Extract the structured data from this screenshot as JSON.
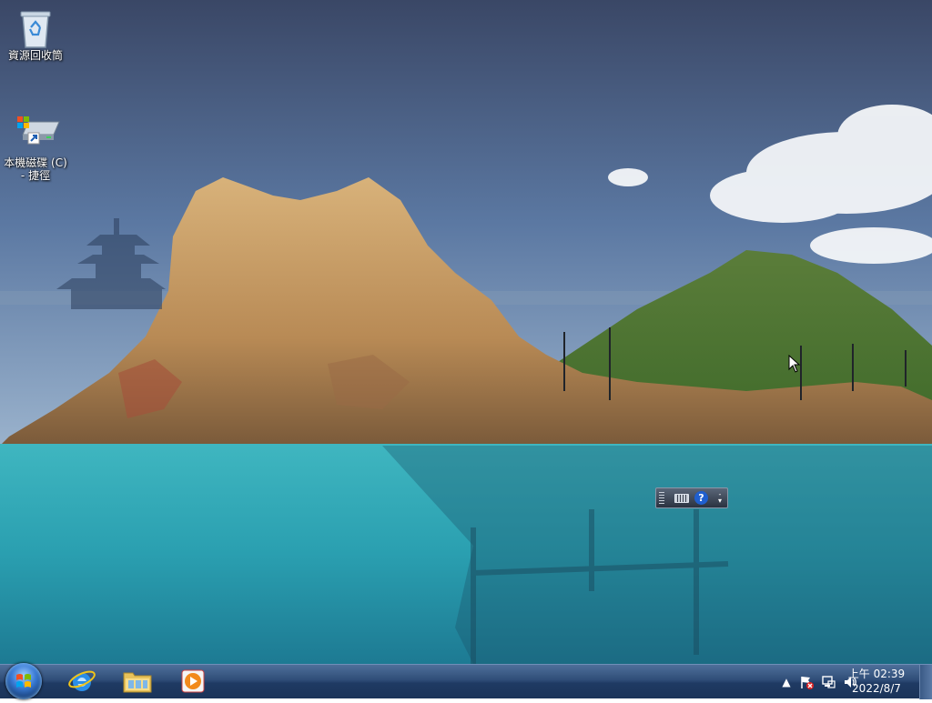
{
  "desktop": {
    "icons": [
      {
        "label": "資源回收筒",
        "icon": "recycle-bin-icon"
      },
      {
        "label": "本機磁碟 (C)\n- 捷徑",
        "icon": "drive-shortcut-icon"
      }
    ]
  },
  "taskbar": {
    "pinned": [
      {
        "name": "internet-explorer",
        "icon": "ie-icon"
      },
      {
        "name": "file-explorer",
        "icon": "folder-icon"
      },
      {
        "name": "media-player",
        "icon": "media-player-icon"
      }
    ],
    "clock": {
      "time": "上午 02:39",
      "date": "2022/8/7"
    },
    "tray_icons": [
      "show-hidden-icons",
      "action-center-flag-icon",
      "network-icon",
      "volume-icon"
    ]
  },
  "language_bar": {
    "help_symbol": "?"
  },
  "colors": {
    "taskbar": "#1f3a63",
    "sea": "#2fa6b3",
    "sky": "#4b6188",
    "accent": "#3a7bd5"
  }
}
